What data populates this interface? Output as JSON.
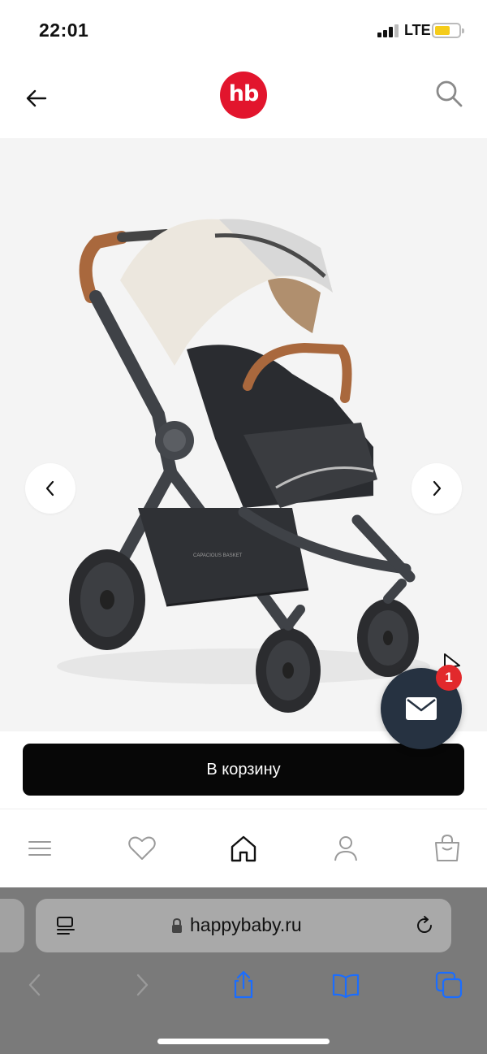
{
  "status_bar": {
    "time": "22:01",
    "network": "LTE",
    "battery_color": "#f5cc1b"
  },
  "header": {
    "logo_text": "hb",
    "logo_color": "#e2152d",
    "back_icon": "arrow-left-icon",
    "search_icon": "search-icon"
  },
  "gallery": {
    "background": "#f4f4f4",
    "prev_icon": "chevron-left-icon",
    "next_icon": "chevron-right-icon",
    "basket_label": "CAPACIOUS BASKET"
  },
  "chat": {
    "icon": "mail-icon",
    "badge_count": "1",
    "badge_color": "#e2292c"
  },
  "cart": {
    "button_label": "В корзину"
  },
  "bottom_nav": {
    "items": [
      {
        "icon": "menu-icon"
      },
      {
        "icon": "heart-icon"
      },
      {
        "icon": "home-icon"
      },
      {
        "icon": "user-icon"
      },
      {
        "icon": "shopping-bag-icon"
      }
    ]
  },
  "browser": {
    "url": "happybaby.ru",
    "accent": "#1a6dff"
  }
}
